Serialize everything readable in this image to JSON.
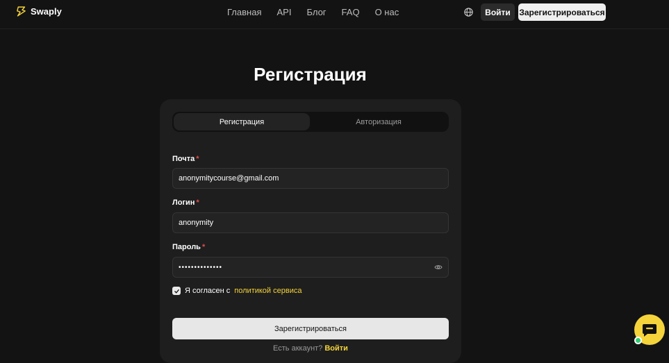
{
  "header": {
    "brand": "Swaply",
    "nav": [
      "Главная",
      "API",
      "Блог",
      "FAQ",
      "О нас"
    ],
    "login_label": "Войти",
    "register_label": "Зарегистрироваться"
  },
  "page": {
    "title": "Регистрация"
  },
  "form": {
    "tabs": [
      {
        "label": "Регистрация",
        "active": true
      },
      {
        "label": "Авторизация",
        "active": false
      }
    ],
    "email": {
      "label": "Почта",
      "required": "*",
      "value": "anonymitycourse@gmail.com"
    },
    "login": {
      "label": "Логин",
      "required": "*",
      "value": "anonymity"
    },
    "password": {
      "label": "Пароль",
      "required": "*",
      "masked_value": "••••••••••••••"
    },
    "agree": {
      "text": "Я согласен с",
      "link": "политикой сервиса",
      "checked": true
    },
    "submit_label": "Зарегистрироваться",
    "have_account": {
      "text": "Есть аккаунт?",
      "link": "Войти"
    }
  },
  "colors": {
    "accent": "#f5d33b",
    "background": "#131313",
    "card": "#1e1e1e",
    "required": "#e34b4b",
    "online": "#2ecc71"
  },
  "icons": [
    "swaply-logo-icon",
    "globe-icon",
    "eye-icon",
    "check-icon",
    "chat-bubble-icon"
  ]
}
